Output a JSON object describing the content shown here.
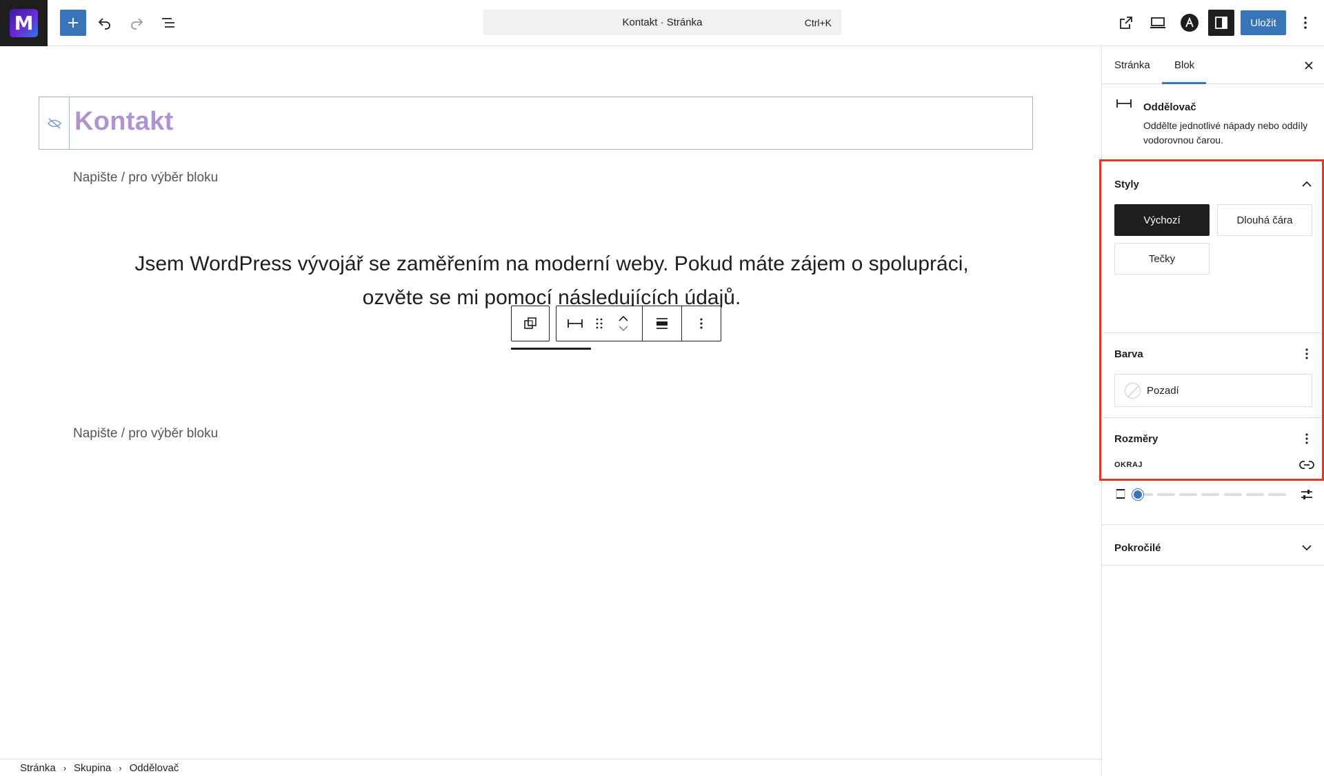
{
  "topbar": {
    "logo_letter": "M",
    "command_title": "Kontakt · Stránka",
    "command_shortcut": "Ctrl+K",
    "save_label": "Uložit",
    "icons": [
      "plus-icon",
      "undo-icon",
      "redo-icon",
      "list-view-icon",
      "external-link-icon",
      "desktop-icon",
      "astra-icon",
      "sidebar-icon",
      "more-vertical-icon"
    ]
  },
  "canvas": {
    "heading": "Kontakt",
    "placeholder_1": "Napište / pro výběr bloku",
    "paragraph": "Jsem WordPress vývojář se zaměřením na moderní weby. Pokud máte zájem o spolupráci, ozvěte se mi pomocí následujících údajů.",
    "placeholder_2": "Napište / pro výběr bloku"
  },
  "breadcrumb": {
    "items": [
      "Stránka",
      "Skupina",
      "Oddělovač"
    ],
    "separator": "›"
  },
  "sidebar": {
    "tabs": [
      {
        "label": "Stránka",
        "active": false
      },
      {
        "label": "Blok",
        "active": true
      }
    ],
    "block": {
      "name": "Oddělovač",
      "description": "Oddělte jednotlivé nápady nebo oddíly vodorovnou čarou."
    },
    "styles": {
      "title": "Styly",
      "options": [
        "Výchozí",
        "Dlouhá čára",
        "Tečky"
      ],
      "selected": "Výchozí"
    },
    "color": {
      "title": "Barva",
      "background_label": "Pozadí"
    },
    "dimensions": {
      "title": "Rozměry",
      "margin_label": "OKRAJ",
      "margin_value_fraction": 0.0
    },
    "advanced": {
      "title": "Pokročilé"
    }
  },
  "colors": {
    "accent": "#3874b8",
    "dark": "#1e1e1e",
    "heading": "#b094d2",
    "highlight": "#e0382a",
    "block_outline": "#9eb6d4"
  }
}
